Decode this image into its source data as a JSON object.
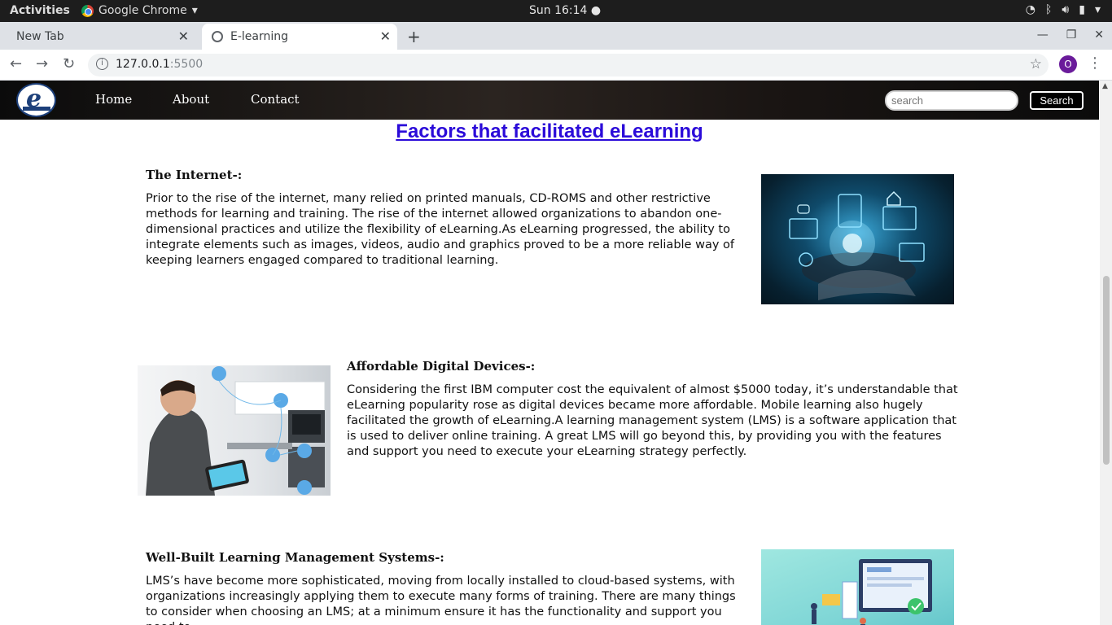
{
  "os": {
    "activities": "Activities",
    "app_menu": "Google Chrome",
    "clock": "Sun 16:14"
  },
  "browser": {
    "tabs": [
      {
        "label": "New Tab"
      },
      {
        "label": "E-learning"
      }
    ],
    "url_host": "127.0.0.1",
    "url_port": ":5500",
    "profile_initial": "O"
  },
  "site": {
    "nav": [
      "Home",
      "About",
      "Contact"
    ],
    "search_placeholder": "search",
    "search_button": "Search",
    "heading": "Factors that facilitated eLearning",
    "sections": [
      {
        "title": "The Internet-:",
        "body": "Prior to the rise of the internet, many relied on printed manuals, CD-ROMS and other restrictive methods for learning and training. The rise of the internet allowed organizations to abandon one-dimensional practices and utilize the flexibility of eLearning.As eLearning progressed, the ability to integrate elements such as images, videos, audio and graphics proved to be a more reliable way of keeping learners engaged compared to traditional learning."
      },
      {
        "title": "Affordable Digital Devices-:",
        "body": "Considering the first IBM computer cost the equivalent of almost $5000 today, it’s understandable that eLearning popularity rose as digital devices became more affordable. Mobile learning also hugely facilitated the growth of eLearning.A learning management system (LMS) is a software application that is used to deliver online training. A great LMS will go beyond this, by providing you with the features and support you need to execute your eLearning strategy perfectly."
      },
      {
        "title": "Well-Built Learning Management Systems-:",
        "body": "LMS’s have become more sophisticated, moving from locally installed to cloud-based systems, with organizations increasingly applying them to execute many forms of training. There are many things to consider when choosing an LMS; at a minimum ensure it has the functionality and support you need to"
      }
    ]
  }
}
